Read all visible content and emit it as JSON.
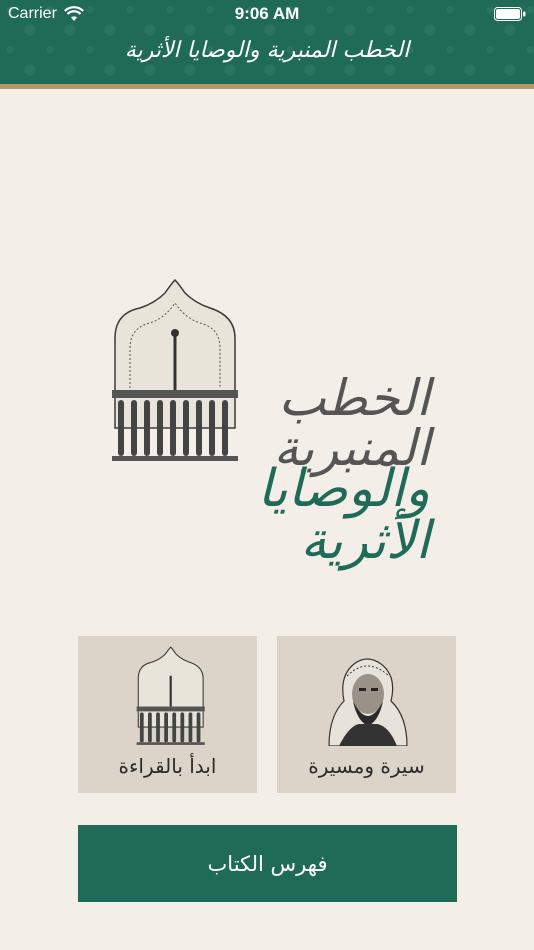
{
  "status_bar": {
    "carrier": "Carrier",
    "time": "9:06 AM"
  },
  "header": {
    "title": "الخطب المنبرية والوصايا الأثرية"
  },
  "logo": {
    "line1": "الخطب المنبرية",
    "line2": "والوصايا الأثرية"
  },
  "cards": {
    "start_reading": {
      "label": "ابدأ بالقراءة",
      "icon": "mihrab-icon"
    },
    "biography": {
      "label": "سيرة ومسيرة",
      "icon": "portrait-icon"
    }
  },
  "index_button": {
    "label": "فهرس الكتاب"
  },
  "colors": {
    "primary": "#1f6b58",
    "gold": "#b3996a",
    "background": "#f3efe8",
    "card": "#dcd4c9"
  }
}
